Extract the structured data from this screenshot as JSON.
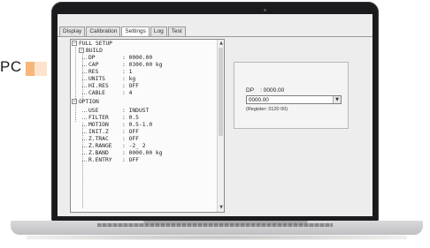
{
  "side_label": "PC",
  "tabs": [
    {
      "label": "Display"
    },
    {
      "label": "Calibration"
    },
    {
      "label": "Settings",
      "active": true
    },
    {
      "label": "Log"
    },
    {
      "label": "Test"
    }
  ],
  "tree": {
    "root": "FULL SETUP",
    "groups": [
      {
        "label": "BUILD",
        "items": [
          {
            "key": "DP",
            "value": "0000.00"
          },
          {
            "key": "CAP",
            "value": "0300.00 kg"
          },
          {
            "key": "RES",
            "value": "1"
          },
          {
            "key": "UNITS",
            "value": "kg"
          },
          {
            "key": "HI.RES",
            "value": "OFF"
          },
          {
            "key": "CABLE",
            "value": "4"
          }
        ]
      },
      {
        "label": "OPTION",
        "items": [
          {
            "key": "USE",
            "value": "INDUST"
          },
          {
            "key": "FILTER",
            "value": "0.5"
          },
          {
            "key": "MOTION",
            "value": "0.5-1.0"
          },
          {
            "key": "INIT.Z",
            "value": "OFF"
          },
          {
            "key": "Z.TRAC",
            "value": "OFF"
          },
          {
            "key": "Z.RANGE",
            "value": "-2_ 2"
          },
          {
            "key": "Z.BAND",
            "value": "0000.00 kg"
          },
          {
            "key": "R.ENTRY",
            "value": "OFF"
          }
        ]
      }
    ]
  },
  "detail": {
    "dp_line": "DP    : 0000.00",
    "dropdown_value": "0000.00",
    "register": "(Register: 0120 00)"
  }
}
